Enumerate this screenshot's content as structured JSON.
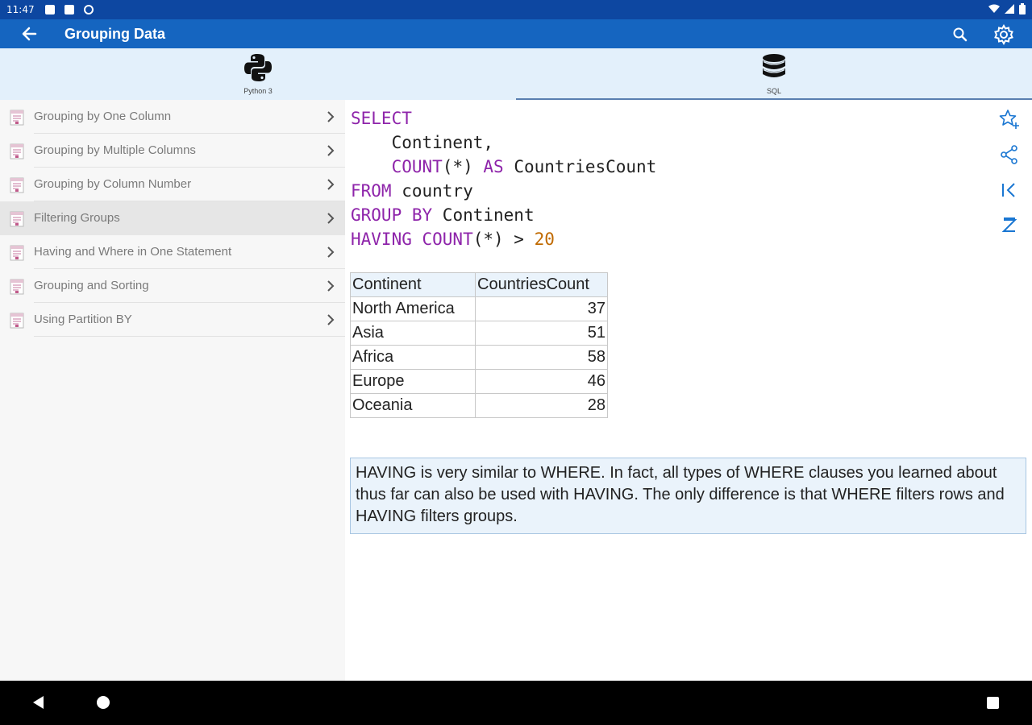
{
  "status_bar": {
    "time": "11:47"
  },
  "app_bar": {
    "title": "Grouping Data",
    "back_icon": "arrow-left-icon",
    "search_icon": "search-icon",
    "settings_icon": "gear-icon"
  },
  "tabs": [
    {
      "label": "Python 3",
      "icon": "python-logo-icon",
      "selected": false
    },
    {
      "label": "SQL",
      "icon": "database-icon",
      "selected": true
    }
  ],
  "sidebar": {
    "items": [
      {
        "label": "Grouping by One Column",
        "active": false
      },
      {
        "label": "Grouping by Multiple Columns",
        "active": false
      },
      {
        "label": "Grouping by Column Number",
        "active": false
      },
      {
        "label": "Filtering Groups",
        "active": true
      },
      {
        "label": "Having and Where in One Statement",
        "active": false
      },
      {
        "label": "Grouping and Sorting",
        "active": false
      },
      {
        "label": "Using Partition BY",
        "active": false
      }
    ]
  },
  "code": {
    "line1_kw": "SELECT",
    "line2_text": "    Continent,",
    "line3_kw_count": "    COUNT",
    "line3_paren": "(*)",
    "line3_kw_as": " AS",
    "line3_text": " CountriesCount",
    "line4_kw": "FROM",
    "line4_text": " country",
    "line5_kw": "GROUP BY",
    "line5_text": " Continent",
    "line6_kw_having": "HAVING",
    "line6_kw_count": " COUNT",
    "line6_text": "(*) > ",
    "line6_num": "20"
  },
  "result": {
    "headers": [
      "Continent",
      "CountriesCount"
    ],
    "rows": [
      [
        "North America",
        "37"
      ],
      [
        "Asia",
        "51"
      ],
      [
        "Africa",
        "58"
      ],
      [
        "Europe",
        "46"
      ],
      [
        "Oceania",
        "28"
      ]
    ]
  },
  "note": {
    "text": "HAVING is very similar to WHERE. In fact, all types of WHERE clauses you learned about thus far can also be used with HAVING. The only difference is that WHERE filters rows and HAVING filters groups."
  },
  "actions": [
    "star-add-icon",
    "share-icon",
    "first-page-icon",
    "sleep-icon"
  ],
  "colors": {
    "status_bar": "#0d47a1",
    "app_bar": "#1565c0",
    "tab_bg": "#e3f0fb",
    "keyword": "#8e24aa",
    "number": "#c06a00",
    "accent_icon": "#1976d2"
  }
}
